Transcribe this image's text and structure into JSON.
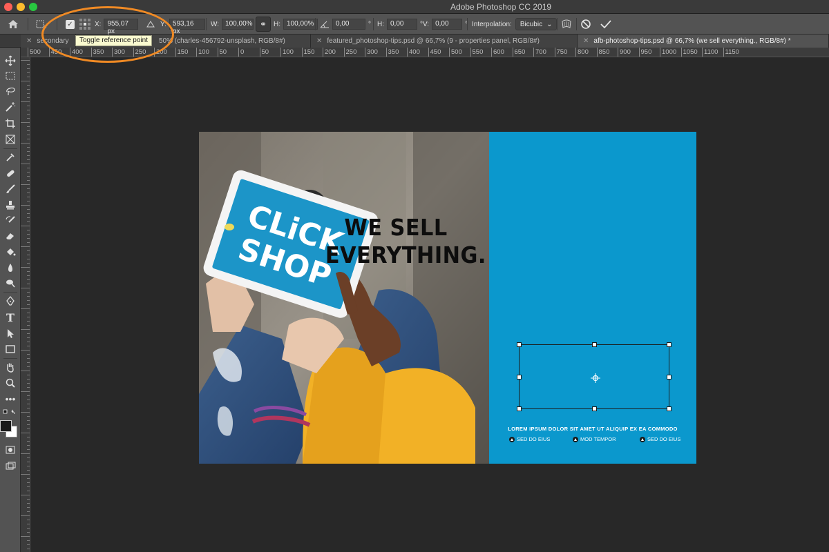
{
  "window": {
    "title": "Adobe Photoshop CC 2019"
  },
  "options_bar": {
    "x_label": "X:",
    "x_value": "955,07 px",
    "y_label": "Y:",
    "y_value": "593,16 px",
    "w_label": "W:",
    "w_value": "100,00%",
    "h_label": "H:",
    "h_value": "100,00%",
    "angle_value": "0,00",
    "degree": "°",
    "hskew_label": "H:",
    "hskew_value": "0,00",
    "vskew_label": "V:",
    "vskew_value": "0,00",
    "interpolation_label": "Interpolation:",
    "interpolation_value": "Bicubic",
    "tooltip": "Toggle reference point"
  },
  "tabs": [
    {
      "label": "secondary",
      "active": false
    },
    {
      "label": "50% (charles-456792-unsplash, RGB/8#)",
      "active": false
    },
    {
      "label": "featured_photoshop-tips.psd @ 66,7% (9 - properties panel, RGB/8#)",
      "active": false
    },
    {
      "label": "afb-photoshop-tips.psd @ 66,7% (we sell everything., RGB/8#) *",
      "active": true
    }
  ],
  "ruler": {
    "top_labels": [
      "500",
      "450",
      "400",
      "350",
      "300",
      "250",
      "200",
      "150",
      "100",
      "50",
      "0",
      "50",
      "100",
      "150",
      "200",
      "250",
      "300",
      "350",
      "400",
      "450",
      "500",
      "550",
      "600",
      "650",
      "700",
      "750",
      "800",
      "850",
      "900",
      "950",
      "1000",
      "1050",
      "1100",
      "1150"
    ]
  },
  "canvas": {
    "headline_line1": "WE SELL",
    "headline_line2": "EVERYTHING.",
    "lorem": "LOREM IPSUM DOLOR SIT AMET UT ALIQUIP EX EA COMMODO",
    "bullets": [
      "SED DO EIUS",
      "MOD TEMPOR",
      "SED DO EIUS"
    ],
    "tablet_word1": "CLiCK",
    "tablet_word2": "SHOP",
    "colors": {
      "blue_panel": "#0b98cd",
      "highlight": "#f08a24"
    }
  },
  "tools": [
    "move-icon",
    "marquee-icon",
    "lasso-icon",
    "magic-wand-icon",
    "crop-icon",
    "frame-icon",
    "eyedropper-icon",
    "healing-brush-icon",
    "brush-icon",
    "stamp-icon",
    "history-brush-icon",
    "eraser-icon",
    "paint-bucket-icon",
    "blur-icon",
    "dodge-icon",
    "pen-icon",
    "type-icon",
    "path-select-icon",
    "rectangle-icon",
    "hand-icon",
    "zoom-icon",
    "more-tools-icon"
  ]
}
